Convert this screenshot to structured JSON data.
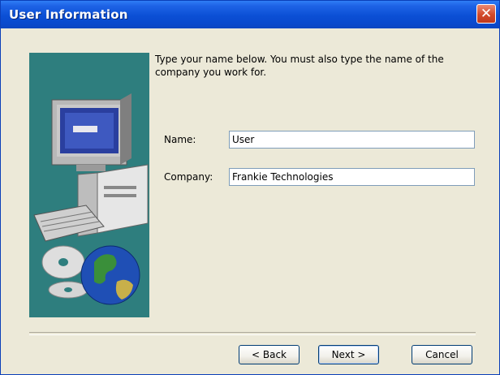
{
  "window": {
    "title": "User Information",
    "close_glyph": "✕"
  },
  "intro": {
    "line1": "Type your name below. You must also type the name of the",
    "line2": "company you work for."
  },
  "form": {
    "name_label": "Name:",
    "name_value": "User",
    "company_label": "Company:",
    "company_value": "Frankie Technologies"
  },
  "buttons": {
    "back": "< Back",
    "next": "Next >",
    "cancel": "Cancel"
  },
  "colors": {
    "titlebar": "#0a4fd5",
    "art_background": "#2e7e7e",
    "dialog_background": "#ece9d8"
  },
  "icons": {
    "close": "close-icon",
    "art": "computer-cd-globe-illustration"
  }
}
